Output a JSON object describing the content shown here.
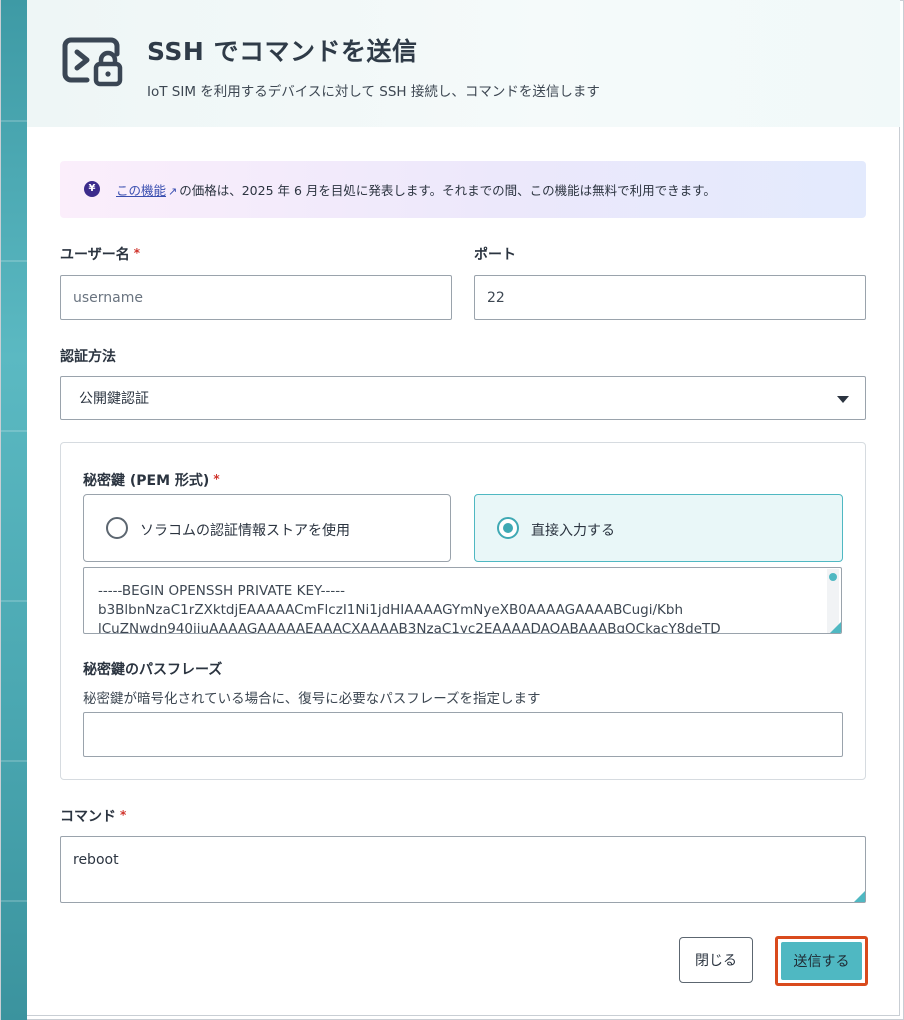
{
  "header": {
    "title": "SSH でコマンドを送信",
    "subtitle": "IoT SIM を利用するデバイスに対して SSH 接続し、コマンドを送信します",
    "icon": "terminal-lock-icon"
  },
  "notice": {
    "icon": "yen-icon",
    "link_text": "この機能",
    "text": "の価格は、2025 年 6 月を目処に発表します。それまでの間、この機能は無料で利用できます。"
  },
  "form": {
    "username": {
      "label": "ユーザー名",
      "required_mark": "*",
      "placeholder": "username"
    },
    "port": {
      "label": "ポート",
      "value": "22"
    },
    "auth_method": {
      "label": "認証方法",
      "selected": "公開鍵認証"
    },
    "private_key": {
      "label": "秘密鍵 (PEM 形式)",
      "required_mark": "*",
      "options": [
        {
          "label": "ソラコムの認証情報ストアを使用",
          "selected": false
        },
        {
          "label": "直接入力する",
          "selected": true
        }
      ],
      "value_lines": [
        "-----BEGIN OPENSSH PRIVATE KEY-----",
        "b3BlbnNzaC1rZXktdjEAAAAACmFlczI1Ni1jdHIAAAAGYmNyeXB0AAAAGAAAABCugi/Kbh",
        "lCuZNwdn940jiuAAAAGAAAAAEAAACXAAAAB3NzaC1yc2EAAAADAQABAAABgQCkacY8deTD"
      ]
    },
    "passphrase": {
      "label": "秘密鍵のパスフレーズ",
      "description": "秘密鍵が暗号化されている場合に、復号に必要なパスフレーズを指定します",
      "value": ""
    },
    "command": {
      "label": "コマンド",
      "required_mark": "*",
      "value": "reboot"
    }
  },
  "footer": {
    "close_label": "閉じる",
    "send_label": "送信する"
  },
  "colors": {
    "accent": "#4fb8c2",
    "highlight_outline": "#d94a1c",
    "required": "#d0342c"
  }
}
